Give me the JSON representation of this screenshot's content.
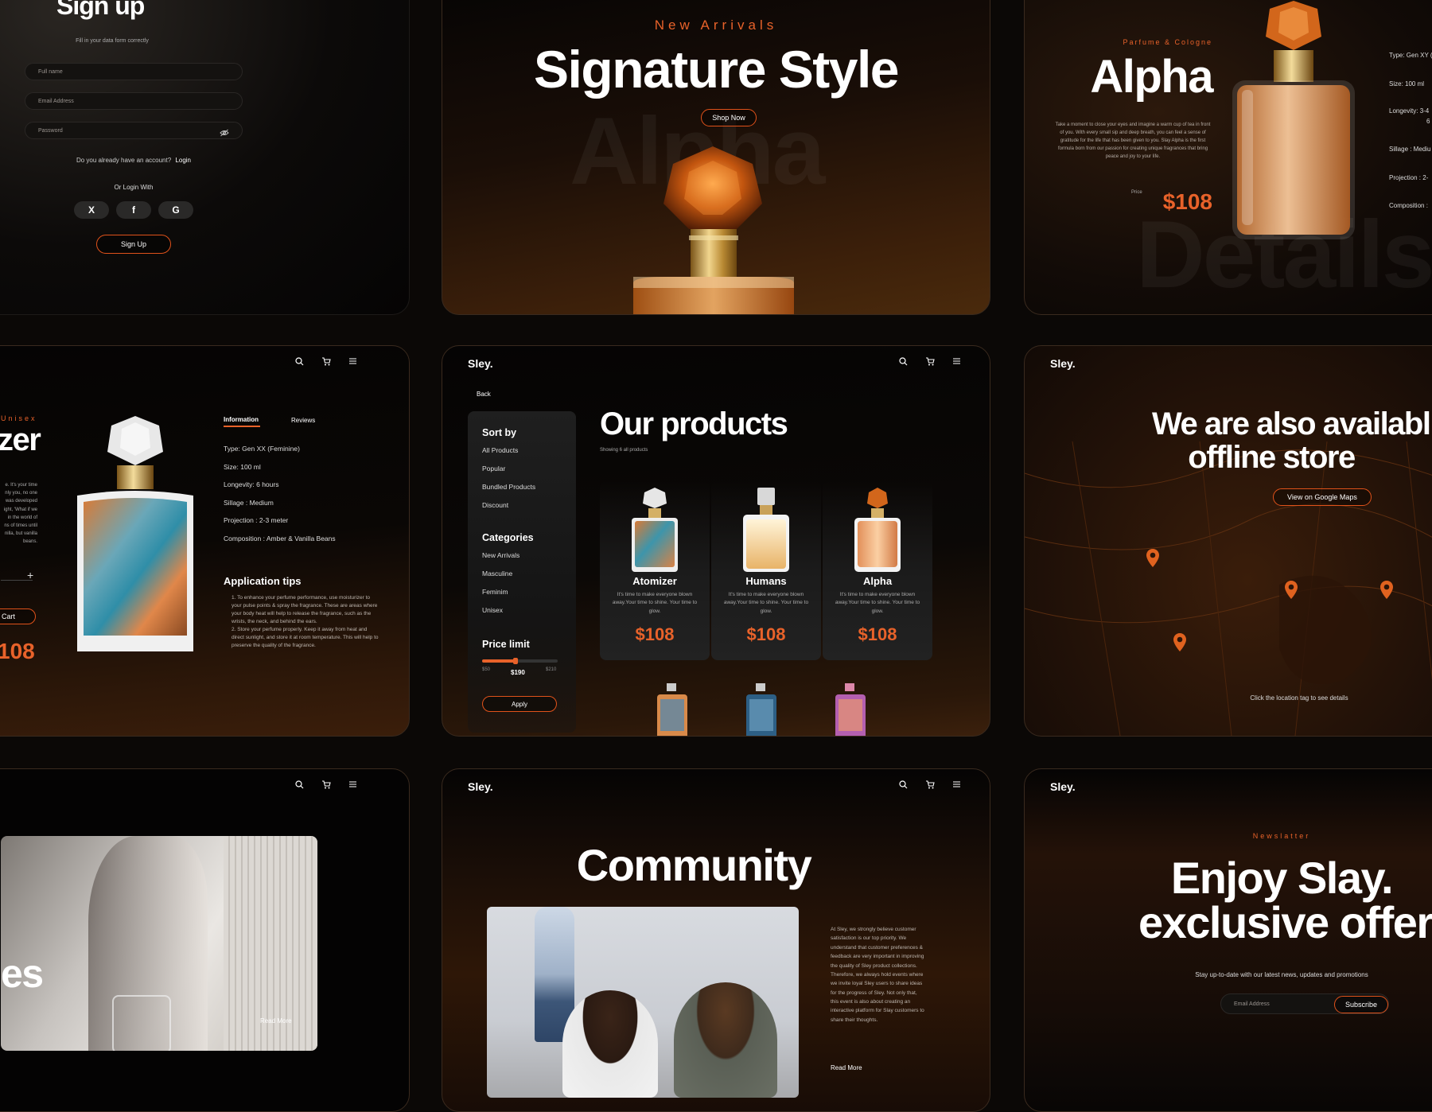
{
  "signup": {
    "title": "Sign up",
    "subtitle": "Fill in your data form correctly",
    "fullname_placeholder": "Full name",
    "email_placeholder": "Email Address",
    "password_placeholder": "Password",
    "account_prompt": "Do you already have an account?",
    "login_link": "Login",
    "or_login_with": "Or Login With",
    "social": [
      "X",
      "f",
      "G"
    ],
    "signup_button": "Sign Up"
  },
  "hero": {
    "eyebrow": "New Arrivals",
    "title": "Signature Style",
    "cta": "Shop Now",
    "ghost_text": "Alpha"
  },
  "alpha_details": {
    "eyebrow": "Parfume & Cologne",
    "title": "Alpha",
    "description": "Take a moment to close your eyes and imagine a warm cup of tea in front of you. With every small sip and deep breath, you can feel a sense of gratitude for the life that has been given to you. Slay Alpha is the first formula born from our passion for creating unique fragrances that bring peace and joy to your life.",
    "price_label": "Price",
    "price": "$108",
    "specs": [
      "Type: Gen XY (",
      "Size: 100 ml",
      "Longevity: 3-4",
      "6 h",
      "Sillage : Mediu",
      "Projection : 2-",
      "Composition :"
    ],
    "ghost_text": "Details"
  },
  "product_detail": {
    "eyebrow": "Unisex",
    "title_partial": "zer",
    "desc_lines": [
      "e. It's your time",
      "nly you, no one",
      "was developed",
      "ight, 'What if we",
      "in the world of",
      "ns of times until",
      "nilla, but vanilla",
      "beans."
    ],
    "cart_label": "Cart",
    "price_partial": "108",
    "tabs": [
      "Information",
      "Reviews"
    ],
    "info": [
      "Type: Gen XX (Feminine)",
      "Size: 100 ml",
      "Longevity: 6 hours",
      "Sillage : Medium",
      "Projection : 2-3 meter",
      "Composition : Amber & Vanilla Beans"
    ],
    "tips_title": "Application tips",
    "tips": [
      "1. To enhance your perfume performance, use moisturizer to your pulse points & spray the fragrance. These are areas where your body heat will help to release the fragrance, such as the wrists, the neck, and behind the ears.",
      "2. Store your perfume properly. Keep it away from heat and direct sunlight, and store it at room temperature. This will help to preserve the quality of the fragrance."
    ]
  },
  "products_page": {
    "brand": "Sley.",
    "back": "Back",
    "sort_title": "Sort by",
    "sort_items": [
      "All Products",
      "Popular",
      "Bundled Products",
      "Discount"
    ],
    "categories_title": "Categories",
    "category_items": [
      "New Arrivals",
      "Masculine",
      "Feminim",
      "Unisex"
    ],
    "price_title": "Price limit",
    "price_min": "$50",
    "price_value": "$190",
    "price_max": "$210",
    "price_fraction": 0.875,
    "apply": "Apply",
    "title": "Our products",
    "showing": "Showing 6 all products",
    "products": [
      {
        "name": "Atomizer",
        "desc": "It's time to make everyone blown away.Your time to shine. Your time to glow.",
        "price": "$108"
      },
      {
        "name": "Humans",
        "desc": "It's time to make everyone blown away.Your time to shine. Your time to glow.",
        "price": "$108"
      },
      {
        "name": "Alpha",
        "desc": "It's time to make everyone blown away.Your time to shine. Your time to glow.",
        "price": "$108"
      }
    ]
  },
  "offline_store": {
    "brand": "Sley.",
    "title_line1": "We are also availabl",
    "title_line2": "offline store",
    "cta": "View on Google Maps",
    "hint": "Click the location tag to see details"
  },
  "stories": {
    "title_partial": "es",
    "read_more": "Read More"
  },
  "community": {
    "brand": "Sley.",
    "title": "Community",
    "body": "At Sley, we strongly believe customer satisfaction is our top priority. We understand that customer preferences & feedback are very important in improving the quality of Sley product collections. Therefore, we always hold events where we invite loyal Sley users to share ideas for the progress of Sley. Not only that, this event is also about creating an interactive platform for Slay customers to share their thoughts.",
    "read_more": "Read More"
  },
  "newsletter": {
    "brand": "Sley.",
    "eyebrow": "Newslatter",
    "title_line1": "Enjoy Slay.",
    "title_line2": "exclusive offer",
    "subtitle": "Stay up-to-date with our latest news, updates and promotions",
    "email_placeholder": "Email Address",
    "subscribe": "Subscribe"
  },
  "colors": {
    "accent": "#e8622a",
    "background": "#0b0806"
  },
  "icons": [
    "search-icon",
    "cart-icon",
    "menu-icon",
    "eye-off-icon",
    "plus-icon",
    "location-pin-icon"
  ]
}
